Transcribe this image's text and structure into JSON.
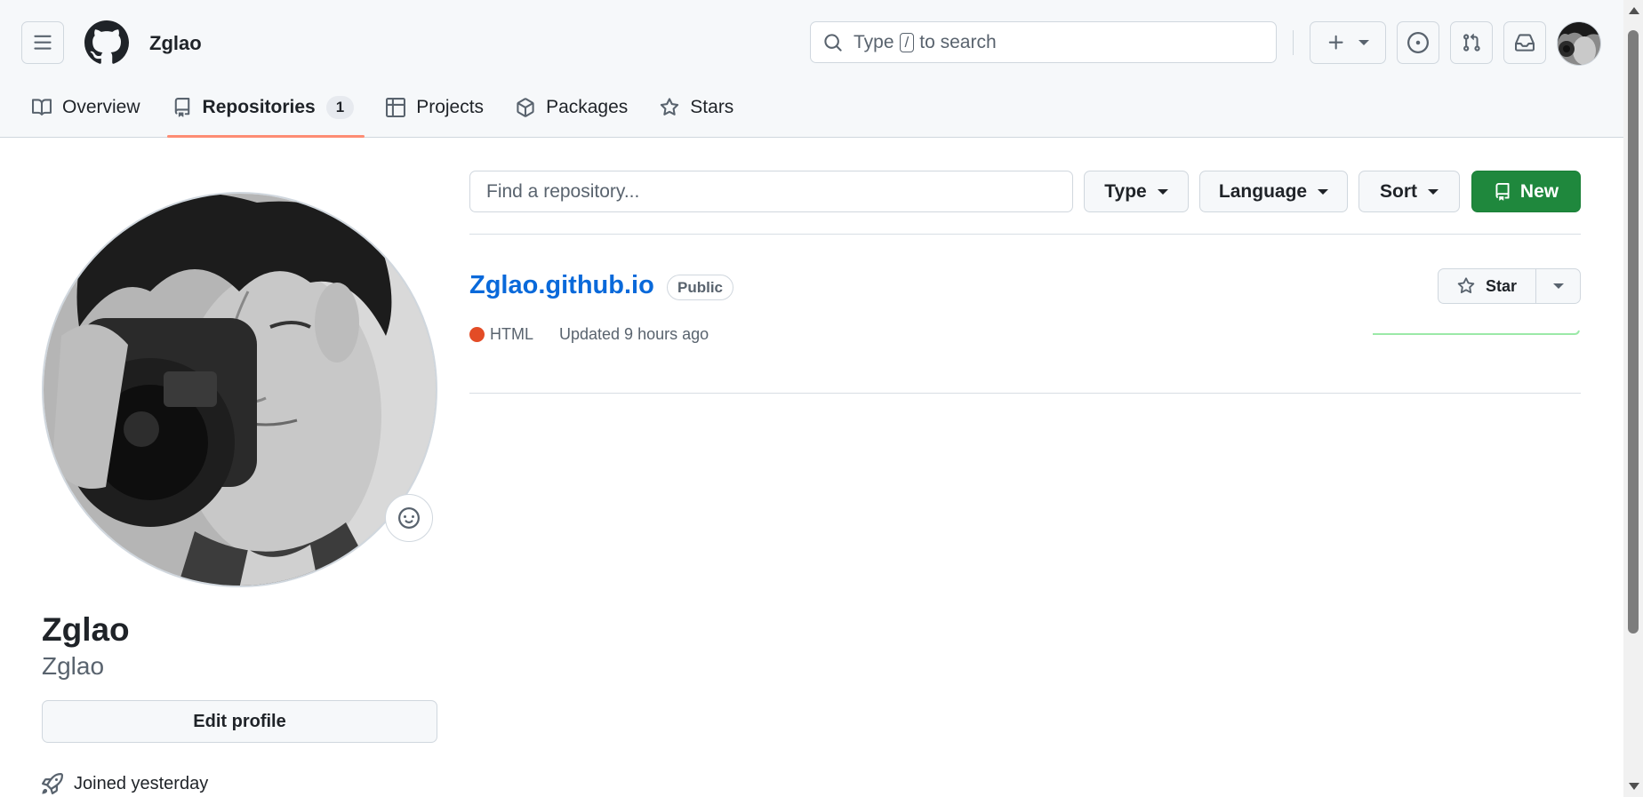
{
  "header": {
    "username": "Zglao",
    "search": {
      "prefix": "Type",
      "key": "/",
      "suffix": "to search"
    },
    "icons": [
      "hamburger-icon",
      "github-logo-icon",
      "search-icon",
      "plus-icon",
      "issue-icon",
      "pull-request-icon",
      "inbox-icon"
    ]
  },
  "tabs": [
    {
      "label": "Overview",
      "icon": "book-icon"
    },
    {
      "label": "Repositories",
      "icon": "repo-icon",
      "count": "1",
      "active": true
    },
    {
      "label": "Projects",
      "icon": "table-icon"
    },
    {
      "label": "Packages",
      "icon": "package-icon"
    },
    {
      "label": "Stars",
      "icon": "star-icon"
    }
  ],
  "profile": {
    "display_name": "Zglao",
    "login": "Zglao",
    "edit_label": "Edit profile",
    "joined": "Joined yesterday"
  },
  "filters": {
    "find_placeholder": "Find a repository...",
    "type_label": "Type",
    "language_label": "Language",
    "sort_label": "Sort",
    "new_label": "New"
  },
  "repos": [
    {
      "name": "Zglao.github.io",
      "visibility": "Public",
      "language": "HTML",
      "language_color": "#e34c26",
      "updated": "Updated 9 hours ago",
      "star_label": "Star"
    }
  ],
  "colors": {
    "accent_underline": "#fd8c73",
    "link": "#0969da",
    "new_button": "#1f883d",
    "sparkline": "#40c463"
  }
}
